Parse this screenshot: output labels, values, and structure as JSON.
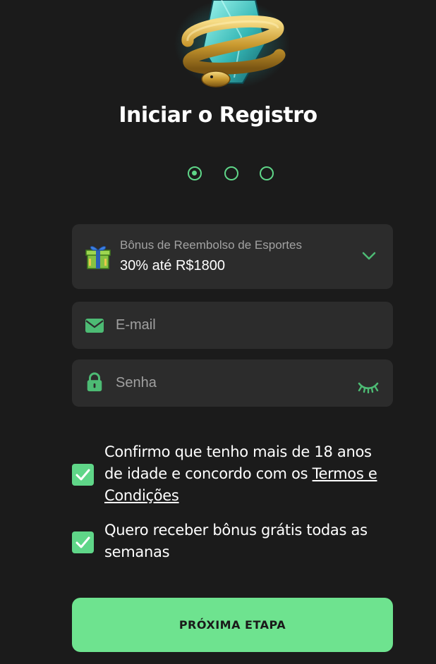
{
  "page": {
    "title": "Iniciar o Registro"
  },
  "steps": {
    "total": 3,
    "current": 1
  },
  "bonus": {
    "icon": "gift-icon",
    "label": "Bônus de Reembolso de Esportes",
    "value": "30% até R$1800",
    "dropdown_icon": "chevron-down-icon"
  },
  "email": {
    "icon": "envelope-icon",
    "placeholder": "E-mail",
    "value": ""
  },
  "password": {
    "icon": "lock-icon",
    "placeholder": "Senha",
    "value": "",
    "toggle_icon": "eye-closed-icon"
  },
  "consents": {
    "age_terms": {
      "checked": true,
      "text": "Confirmo que tenho mais de 18 anos de idade e concordo com os ",
      "link": "Termos e Condições"
    },
    "weekly_bonus": {
      "checked": true,
      "text": "Quero receber bônus grátis todas as semanas"
    }
  },
  "actions": {
    "next_label": "PRÓXIMA ETAPA"
  },
  "colors": {
    "background": "#1b1b1b",
    "panel": "#2c2c2c",
    "accent": "#5fd688",
    "button": "#6ee38f",
    "muted_text": "#a2a2a2"
  }
}
